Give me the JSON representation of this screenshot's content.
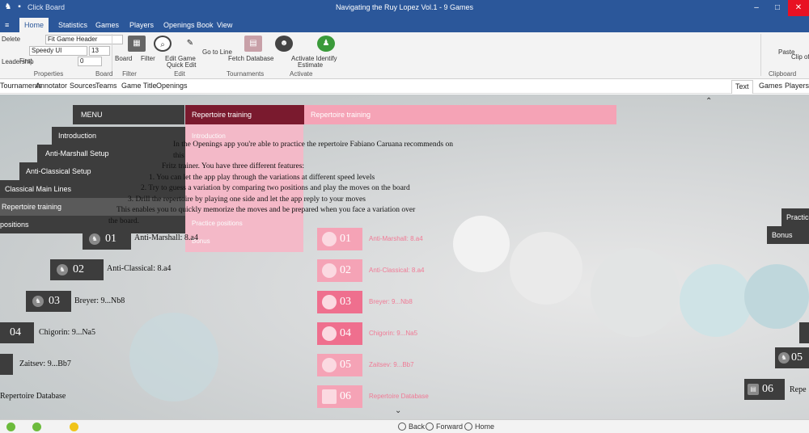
{
  "titlebar": {
    "app_title": "Click Board",
    "doc_title": "Navigating the Ruy Lopez Vol.1 - 9 Games"
  },
  "ribbon_tabs": [
    "Home",
    "Statistics",
    "Games",
    "Players",
    "Openings Book",
    "View"
  ],
  "ribbon": {
    "left_labels": [
      "Delete",
      "Leadership",
      "First"
    ],
    "game_header_value": "Fit Game Header",
    "source_value": "Speedy UI",
    "number_value": "13",
    "count_value": "0",
    "buttons": [
      "Board",
      "Filter",
      "Edit Game",
      "Quick Edit",
      "Go to Line",
      "Fetch Database",
      "Activate Identify",
      "Estimate"
    ],
    "group_labels": [
      "Properties",
      "Board",
      "Filter",
      "Edit",
      "Tournaments",
      "Activate",
      "Clipboard"
    ],
    "right_labels": [
      "Paste",
      "Clip of"
    ]
  },
  "subtabs": {
    "left": [
      "Tournaments",
      "Annotator",
      "Sources",
      "Teams",
      "Game Title",
      "Openings"
    ],
    "right": [
      "Text",
      "Games",
      "Players"
    ]
  },
  "menu": {
    "header": "MENU",
    "items": [
      "Introduction",
      "Anti-Marshall Setup",
      "Anti-Classical Setup",
      "Classical Main Lines",
      "Repertoire training",
      "positions"
    ]
  },
  "section": {
    "title": "Repertoire training",
    "right_title": "Repertoire training",
    "pink_items": [
      "Introduction",
      "Practice positions",
      "Bonus"
    ]
  },
  "intro_text": {
    "line1": "In the Openings app you're able to practice the repertoire Fabiano Caruana recommends on this",
    "line2": "Fritz trainer. You have three different features:",
    "item1": "1. You can let the app play through the variations at different speed levels",
    "item2": "2. Try to guess a variation by comparing two positions and play the moves on the board",
    "item3": "3. Drill the repertoire by playing one side and let the app reply to your moves",
    "line3": "This enables you to quickly memorize the moves and be prepared when you face a variation over",
    "line4": "the board."
  },
  "entries": [
    {
      "num": "01",
      "label": "Anti-Marshall: 8.a4"
    },
    {
      "num": "02",
      "label": "Anti-Classical: 8.a4"
    },
    {
      "num": "03",
      "label": "Breyer: 9...Nb8"
    },
    {
      "num": "04",
      "label": "Chigorin: 9...Na5"
    },
    {
      "num": "05",
      "label": "Zaitsev: 9...Bb7"
    },
    {
      "num": "06",
      "label": "Repertoire Database"
    }
  ],
  "right_entries": [
    {
      "num": "01",
      "label": "Anti-Marshall: 8.a4"
    },
    {
      "num": "02",
      "label": "Anti-Classical: 8.a4"
    },
    {
      "num": "03",
      "label": "Breyer: 9...Nb8"
    },
    {
      "num": "04",
      "label": "Chigorin: 9...Na5"
    },
    {
      "num": "05",
      "label": "Zaitsev: 9...Bb7"
    },
    {
      "num": "06",
      "label": "Repertoire Database"
    }
  ],
  "far_right": {
    "items": [
      "Practice",
      "Bonus"
    ],
    "badges": [
      "05",
      "06"
    ],
    "cut_label": "Repe"
  },
  "bottom_nav": {
    "back": "Back",
    "forward": "Forward",
    "home": "Home"
  },
  "colors": {
    "accent": "#2b579a",
    "dark_red": "#7a1a2e",
    "pink": "#f5a3b6",
    "dark_panel": "#3d3d3d"
  }
}
